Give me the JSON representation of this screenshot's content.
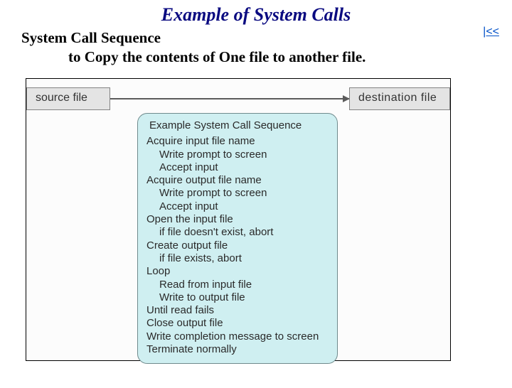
{
  "title": "Example of System Calls",
  "subtitle": {
    "line1": "System Call Sequence",
    "line2": "to Copy the contents of One file to another file."
  },
  "backLink": "|<<",
  "diagram": {
    "source": "source file",
    "destination": "destination  file",
    "sequenceTitle": "Example System Call Sequence",
    "steps": [
      {
        "text": "Acquire input file name",
        "indent": 0
      },
      {
        "text": "Write prompt to screen",
        "indent": 1
      },
      {
        "text": "Accept input",
        "indent": 1
      },
      {
        "text": "Acquire output file name",
        "indent": 0
      },
      {
        "text": "Write prompt to screen",
        "indent": 1
      },
      {
        "text": "Accept input",
        "indent": 1
      },
      {
        "text": "Open the input file",
        "indent": 0
      },
      {
        "text": "if file doesn't exist, abort",
        "indent": 1
      },
      {
        "text": "Create output file",
        "indent": 0
      },
      {
        "text": "if file exists, abort",
        "indent": 1
      },
      {
        "text": "Loop",
        "indent": 0
      },
      {
        "text": "Read from input file",
        "indent": 1
      },
      {
        "text": "Write to output file",
        "indent": 1
      },
      {
        "text": "Until read fails",
        "indent": 0
      },
      {
        "text": "Close output file",
        "indent": 0
      },
      {
        "text": "Write completion message to screen",
        "indent": 0
      },
      {
        "text": "Terminate normally",
        "indent": 0
      }
    ]
  }
}
